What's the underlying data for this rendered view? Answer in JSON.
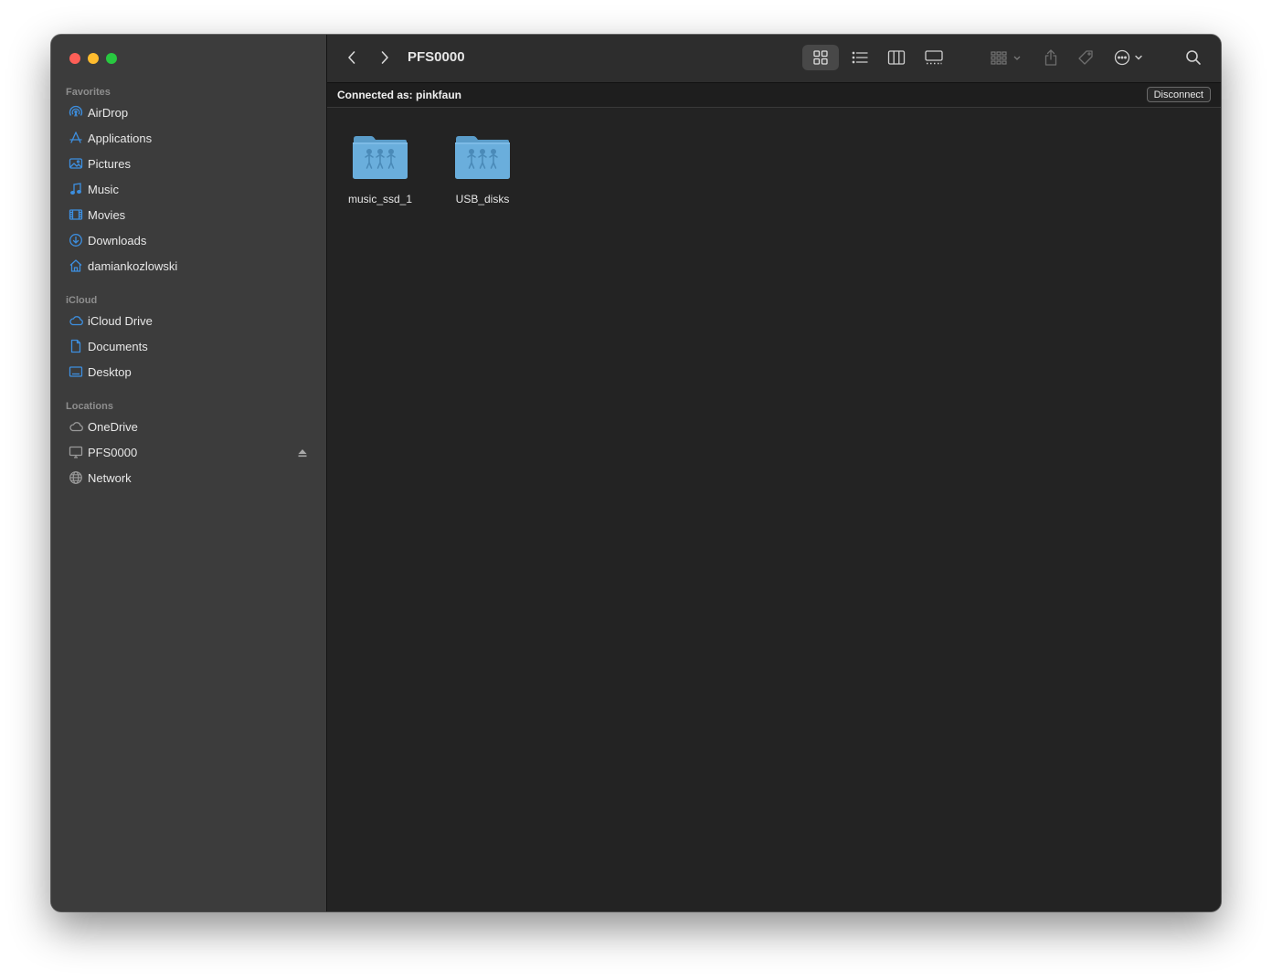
{
  "window": {
    "title": "PFS0000"
  },
  "sidebar": {
    "favorites_title": "Favorites",
    "favorites": [
      {
        "label": "AirDrop",
        "icon": "airdrop-icon"
      },
      {
        "label": "Applications",
        "icon": "applications-icon"
      },
      {
        "label": "Pictures",
        "icon": "pictures-icon"
      },
      {
        "label": "Music",
        "icon": "music-icon"
      },
      {
        "label": "Movies",
        "icon": "movies-icon"
      },
      {
        "label": "Downloads",
        "icon": "downloads-icon"
      },
      {
        "label": "damiankozlowski",
        "icon": "home-icon"
      }
    ],
    "icloud_title": "iCloud",
    "icloud": [
      {
        "label": "iCloud Drive",
        "icon": "cloud-icon"
      },
      {
        "label": "Documents",
        "icon": "document-icon"
      },
      {
        "label": "Desktop",
        "icon": "desktop-icon"
      }
    ],
    "locations_title": "Locations",
    "locations": [
      {
        "label": "OneDrive",
        "icon": "cloud-icon"
      },
      {
        "label": "PFS0000",
        "icon": "display-icon"
      },
      {
        "label": "Network",
        "icon": "globe-icon"
      }
    ]
  },
  "connection": {
    "text": "Connected as: pinkfaun",
    "disconnect_label": "Disconnect"
  },
  "files": [
    {
      "name": "music_ssd_1",
      "icon": "shared-folder-icon"
    },
    {
      "name": "USB_disks",
      "icon": "shared-folder-icon"
    }
  ],
  "colors": {
    "accent": "#3d8fe0",
    "folder": "#6aaedc",
    "sidebar_bg": "#3c3c3c",
    "main_bg": "#232323"
  }
}
